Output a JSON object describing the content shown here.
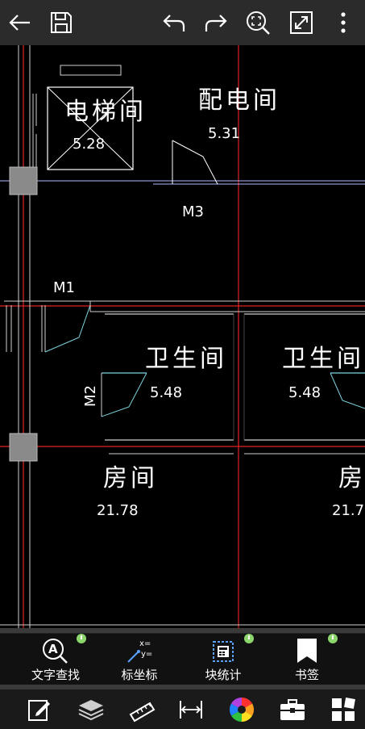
{
  "topbar": {
    "icons": [
      "back-arrow-icon",
      "save-icon",
      "undo-icon",
      "redo-icon",
      "zoom-fit-icon",
      "fullscreen-icon",
      "more-vert-icon"
    ]
  },
  "drawing": {
    "rooms": [
      {
        "name": "电梯间",
        "elevation": "5.28"
      },
      {
        "name": "配电间",
        "elevation": "5.31"
      },
      {
        "name": "卫生间",
        "elevation": "5.48"
      },
      {
        "name": "卫生间",
        "elevation": "5.48"
      },
      {
        "name": "房间",
        "elevation": "21.78"
      },
      {
        "name": "房",
        "elevation": "21.7"
      }
    ],
    "door_labels": [
      "M3",
      "M1",
      "M2"
    ]
  },
  "tools": [
    {
      "label": "文字查找",
      "icon": "text-search-icon"
    },
    {
      "label": "标坐标",
      "icon": "coordinate-icon"
    },
    {
      "label": "块统计",
      "icon": "block-count-icon"
    },
    {
      "label": "书签",
      "icon": "bookmark-icon"
    }
  ],
  "bottombar": {
    "icons": [
      "edit-icon",
      "layers-icon",
      "ruler-icon",
      "dimension-icon",
      "color-wheel-icon",
      "toolbox-icon",
      "grid-menu-icon"
    ]
  }
}
